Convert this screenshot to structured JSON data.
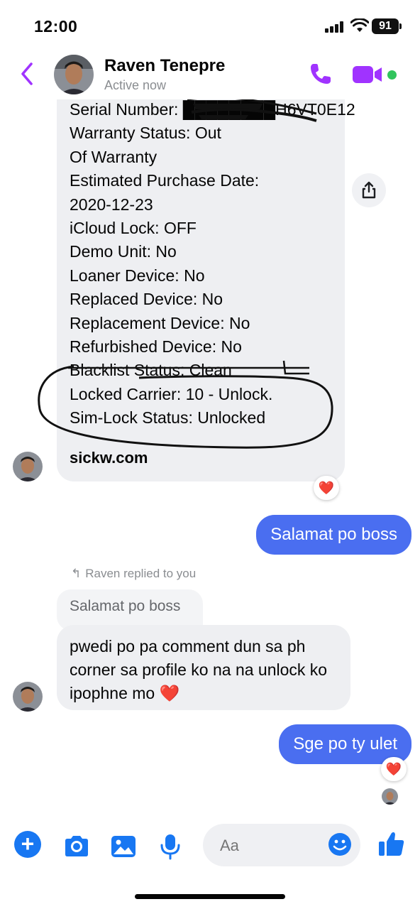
{
  "status_bar": {
    "time": "12:00",
    "battery": "91"
  },
  "header": {
    "contact_name": "Raven Tenepre",
    "presence": "Active now"
  },
  "messages": {
    "device_info_lines": [
      "Serial Number: ████████H6VT0E12",
      "Warranty Status: Out",
      "Of Warranty",
      "Estimated Purchase Date:",
      "2020-12-23",
      "iCloud Lock: OFF",
      "Demo Unit: No",
      "Loaner Device: No",
      "Replaced Device: No",
      "Replacement Device: No",
      "Refurbished Device: No",
      "Blacklist Status: Clean",
      "Locked Carrier: 10 - Unlock.",
      "Sim-Lock Status: Unlocked"
    ],
    "device_info_site": "sickw.com",
    "outgoing_1": "Salamat po boss",
    "replied_label": "Raven replied to you",
    "quoted_text": "Salamat po boss",
    "incoming_reply": "pwedi po pa comment dun sa ph corner sa profile ko na na unlock ko ipophne mo",
    "incoming_reply_emoji": "❤️",
    "outgoing_2": "Sge po ty ulet",
    "reaction_emoji": "❤️"
  },
  "composer": {
    "placeholder": "Aa"
  },
  "colors": {
    "messenger_purple": "#a033ff",
    "outgoing_bubble": "#4a6ef0",
    "composer_blue": "#1877f2",
    "online": "#31c45c",
    "heart": "#e41e3f"
  },
  "icons": [
    "back-chevron-icon",
    "phone-icon",
    "video-camera-icon",
    "share-icon",
    "plus-icon",
    "camera-icon",
    "gallery-icon",
    "microphone-icon",
    "emoji-icon",
    "thumbs-up-icon",
    "reply-arrow-icon"
  ]
}
